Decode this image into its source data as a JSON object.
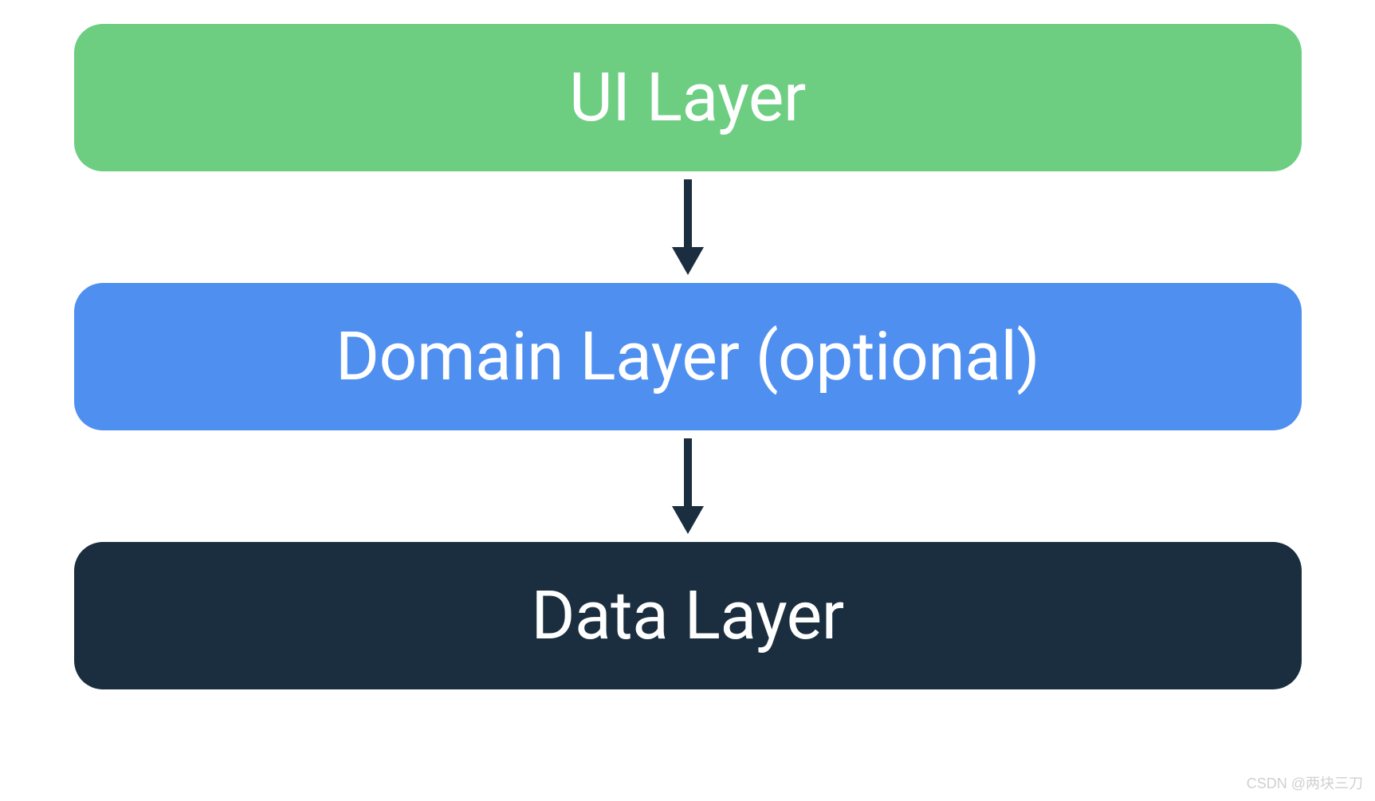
{
  "diagram": {
    "layers": [
      {
        "id": "ui",
        "label": "UI Layer",
        "color": "#6dce82"
      },
      {
        "id": "domain",
        "label": "Domain Layer (optional)",
        "color": "#4f8ff0"
      },
      {
        "id": "data",
        "label": "Data Layer",
        "color": "#1a2e3f"
      }
    ],
    "arrow_color": "#1a2e3f"
  },
  "watermark": "CSDN @两块三刀"
}
